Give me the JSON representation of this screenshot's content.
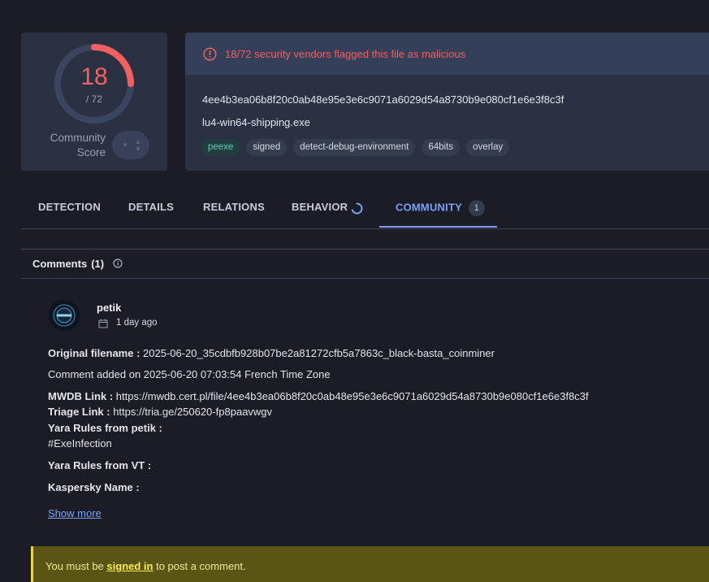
{
  "score": {
    "detected": "18",
    "total": "/ 72",
    "detected_fraction": 0.25,
    "community_label_line1": "Community",
    "community_label_line2": "Score"
  },
  "alert": {
    "text": "18/72 security vendors flagged this file as malicious",
    "color": "#f26060"
  },
  "file": {
    "hash": "4ee4b3ea06b8f20c0ab48e95e3e6c9071a6029d54a8730b9e080cf1e6e3f8c3f",
    "name": "lu4-win64-shipping.exe",
    "tags": [
      "peexe",
      "signed",
      "detect-debug-environment",
      "64bits",
      "overlay"
    ]
  },
  "tabs": {
    "detection": "DETECTION",
    "details": "DETAILS",
    "relations": "RELATIONS",
    "behavior": "BEHAVIOR",
    "community": "COMMUNITY",
    "community_badge": "1"
  },
  "comments": {
    "title": "Comments",
    "count": "(1)"
  },
  "comment": {
    "user": "petik",
    "time": "1 day ago",
    "original_filename_label": "Original filename :",
    "original_filename_value": " 2025-06-20_35cdbfb928b07be2a81272cfb5a7863c_black-basta_coinminer",
    "added": "Comment added on 2025-06-20 07:03:54 French Time Zone",
    "mwdb_label": "MWDB Link :",
    "mwdb_value": " https://mwdb.cert.pl/file/4ee4b3ea06b8f20c0ab48e95e3e6c9071a6029d54a8730b9e080cf1e6e3f8c3f",
    "triage_label": "Triage Link :",
    "triage_value": " https://tria.ge/250620-fp8paavwgv",
    "yara_petik_label": "Yara Rules from petik :",
    "yara_petik_value": "#ExeInfection",
    "yara_vt_label": "Yara Rules from VT :",
    "kaspersky_label": "Kaspersky Name :",
    "show_more": "Show more"
  },
  "signin": {
    "prefix": "You must be ",
    "link": "signed in",
    "suffix": " to post a comment."
  },
  "colors": {
    "background": "#1b1c26",
    "card": "#2a3142",
    "accent": "#7aa2f7",
    "danger": "#f26060",
    "warning_bg": "#5b5515"
  },
  "icons": [
    "alert-circle-icon",
    "spinner-icon",
    "info-icon",
    "calendar-icon",
    "chevron-up-icon",
    "chevron-down-icon"
  ]
}
